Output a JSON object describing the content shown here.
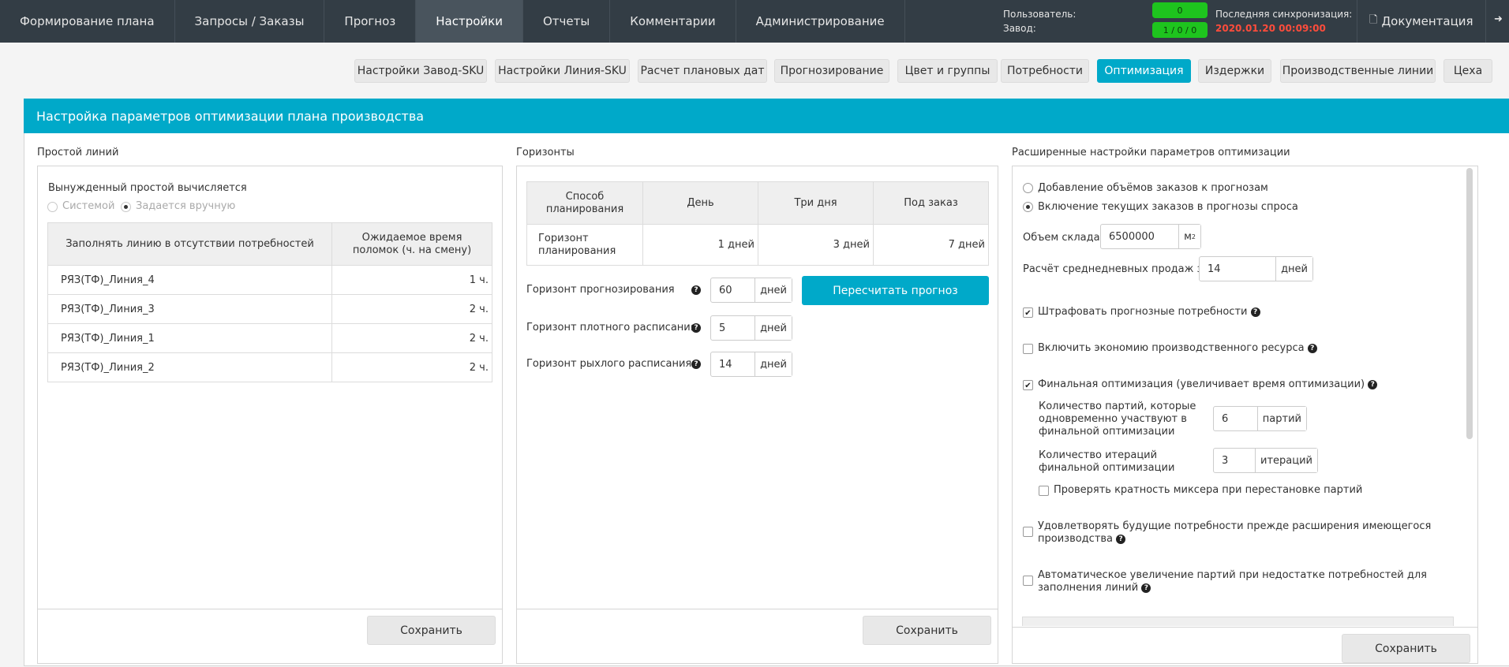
{
  "nav": {
    "items": [
      "Формирование плана",
      "Запросы / Заказы",
      "Прогноз",
      "Настройки",
      "Отчеты",
      "Комментарии",
      "Администрирование"
    ],
    "user_label": "Пользователь:",
    "plant_label": "Завод:",
    "badge_top": "0",
    "badge_bottom": "1 / 0 / 0",
    "sync_label": "Последняя синхронизация:",
    "sync_time": "2020.01.20 00:09:00",
    "docs_label": "Документация",
    "docs_icon": "document-icon",
    "exit_icon": "sign-out-icon"
  },
  "subtabs": [
    "Настройки Завод-SKU",
    "Настройки Линия-SKU",
    "Расчет плановых дат",
    "Прогнозирование",
    "Цвет и группы",
    "Потребности",
    "Оптимизация",
    "Издержки",
    "Производственные линии",
    "Цеха"
  ],
  "panel_title": "Настройка параметров оптимизации плана производства",
  "downtime": {
    "title": "Простой линий",
    "forced_label": "Вынужденный простой вычисляется",
    "radio_system": "Системой",
    "radio_manual": "Задается вручную",
    "col1": "Заполнять линию в отсутствии потребностей",
    "col2": "Ожидаемое время поломок (ч. на смену)",
    "rows": [
      {
        "line": "РЯЗ(ТФ)_Линия_4",
        "value": "1 ч."
      },
      {
        "line": "РЯЗ(ТФ)_Линия_3",
        "value": "2 ч."
      },
      {
        "line": "РЯЗ(ТФ)_Линия_1",
        "value": "2 ч."
      },
      {
        "line": "РЯЗ(ТФ)_Линия_2",
        "value": "2 ч."
      }
    ],
    "save": "Сохранить"
  },
  "horizons": {
    "title": "Горизонты",
    "head": [
      "Способ планирования",
      "День",
      "Три дня",
      "Под заказ"
    ],
    "row_label": "Горизонт планирования",
    "row_values": [
      "1 дней",
      "3 дней",
      "7 дней"
    ],
    "forecast_label": "Горизонт прогнозирования",
    "forecast_value": "60",
    "dense_label": "Горизонт плотного расписания",
    "dense_value": "5",
    "loose_label": "Горизонт рыхлого расписания",
    "loose_value": "14",
    "unit_days": "дней",
    "recalc": "Пересчитать прогноз",
    "save": "Сохранить"
  },
  "advanced": {
    "title": "Расширенные настройки параметров оптимизации",
    "radio_add": "Добавление объёмов заказов к прогнозам",
    "radio_include": "Включение текущих заказов в прогнозы спроса",
    "storage_label": "Объем склада",
    "storage_value": "6500000",
    "storage_unit": "м",
    "storage_unit_sup": "2",
    "avg_label": "Расчёт среднедневных продаж за",
    "avg_value": "14",
    "avg_unit": "дней",
    "penalize": "Штрафовать прогнозные потребности",
    "economy": "Включить экономию производственного ресурса",
    "final_opt": "Финальная оптимизация (увеличивает время оптимизации)",
    "batches_l1": "Количество партий, которые",
    "batches_l2": "одновременно участвуют в",
    "batches_l3": "финальной оптимизации",
    "batches_value": "6",
    "batches_unit": "партий",
    "iter_l1": "Количество итераций",
    "iter_l2": "финальной оптимизации",
    "iter_value": "3",
    "iter_unit": "итераций",
    "mixer": "Проверять кратность миксера при перестановке партий",
    "future_l1": "Удовлетворять будущие потребности прежде расширения имеющегося",
    "future_l2": "производства",
    "auto_l1": "Автоматическое увеличение партий при недостатке потребностей для",
    "auto_l2": "заполнения линий",
    "save": "Сохранить"
  }
}
